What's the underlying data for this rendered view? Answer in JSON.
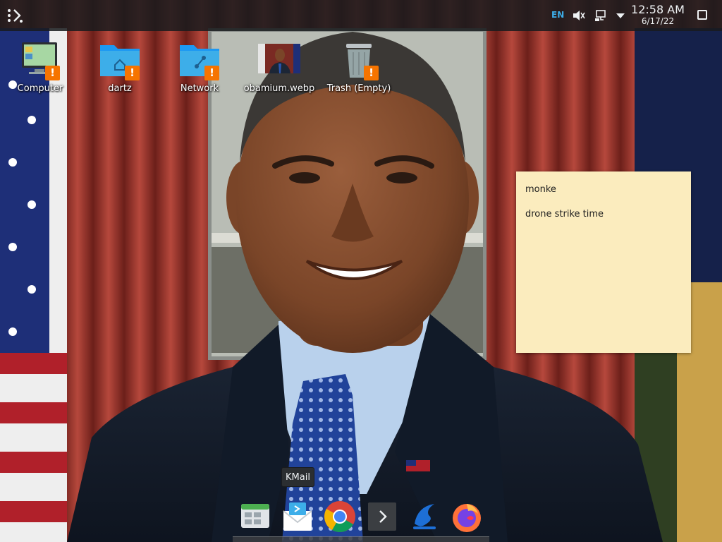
{
  "top_panel": {
    "keyboard_layout": "EN",
    "clock_time": "12:58 AM",
    "clock_date": "6/17/22",
    "icons": [
      "launcher-icon",
      "volume-muted-icon",
      "network-icon",
      "tray-expand-icon",
      "show-desktop-icon"
    ]
  },
  "desktop_icons": [
    {
      "label": "Computer",
      "icon": "computer-icon"
    },
    {
      "label": "dartz",
      "icon": "home-folder-icon"
    },
    {
      "label": "Network",
      "icon": "network-folder-icon"
    },
    {
      "label": "obamium.webp",
      "icon": "image-thumbnail-icon"
    },
    {
      "label": "Trash (Empty)",
      "icon": "trash-icon"
    }
  ],
  "sticky_note": {
    "line1": "monke",
    "line2": "drone strike time"
  },
  "dock": {
    "tooltip": "KMail",
    "apps": [
      "files-icon",
      "kmail-icon",
      "chrome-icon",
      "terminal-icon",
      "app-icon",
      "firefox-icon"
    ]
  },
  "colors": {
    "panel_bg": "#191b1d",
    "accent": "#3daee9",
    "warning": "#f67400",
    "note_bg": "#fbecbe"
  }
}
